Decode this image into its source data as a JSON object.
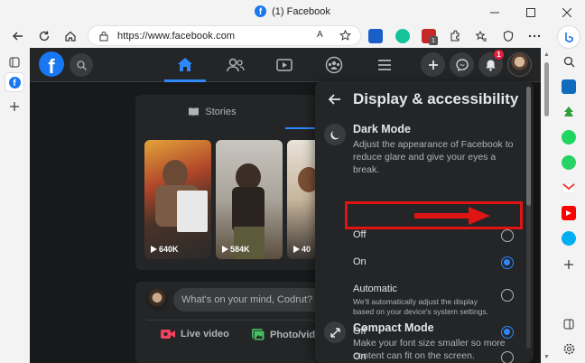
{
  "browser": {
    "window_title": "(1) Facebook",
    "url": "https://www.facebook.com",
    "read_aloud_label": "A",
    "extension_badge_count": "1"
  },
  "fb": {
    "logo_letter": "f",
    "notification_count": "1",
    "stories_label": "Stories",
    "stories": [
      {
        "views": "640K"
      },
      {
        "views": "584K"
      },
      {
        "views": "40"
      }
    ],
    "composer_placeholder": "What's on your mind, Codrut?",
    "actions": [
      {
        "label": "Live video"
      },
      {
        "label": "Photo/video"
      }
    ],
    "colors": {
      "accent": "#2d88ff",
      "brand": "#1877f2",
      "highlight": "#e11414"
    }
  },
  "settings": {
    "title": "Display & accessibility",
    "dark_mode": {
      "title": "Dark Mode",
      "description": "Adjust the appearance of Facebook to reduce glare and give your eyes a break.",
      "options": [
        {
          "label": "Off",
          "selected": false
        },
        {
          "label": "On",
          "selected": true
        },
        {
          "label": "Automatic",
          "sub": "We'll automatically adjust the display based on your device's system settings.",
          "selected": false
        }
      ]
    },
    "compact_mode": {
      "title": "Compact Mode",
      "description": "Make your font size smaller so more content can fit on the screen.",
      "options": [
        {
          "label": "Off",
          "selected": true
        },
        {
          "label": "On",
          "selected": false
        }
      ]
    }
  }
}
